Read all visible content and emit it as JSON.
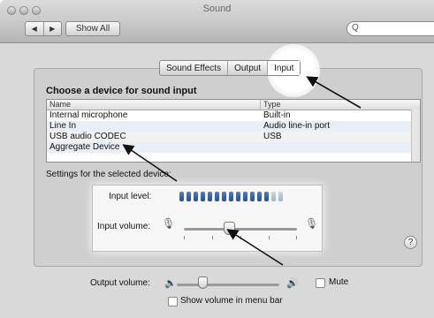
{
  "window": {
    "title": "Sound"
  },
  "toolbar": {
    "back_label": "◀",
    "forward_label": "▶",
    "show_all_label": "Show All",
    "search_icon": "Q"
  },
  "tabs": [
    {
      "label": "Sound Effects",
      "active": false
    },
    {
      "label": "Output",
      "active": false
    },
    {
      "label": "Input",
      "active": true
    }
  ],
  "input": {
    "heading": "Choose a device for sound input",
    "columns": {
      "name": "Name",
      "type": "Type"
    },
    "devices": [
      {
        "name": "Internal microphone",
        "type": "Built-in"
      },
      {
        "name": "Line In",
        "type": "Audio line-in port"
      },
      {
        "name": "USB audio CODEC",
        "type": "USB",
        "selected": true
      },
      {
        "name": "Aggregate Device",
        "type": ""
      }
    ],
    "settings_label": "Settings for the selected device:",
    "level_label": "Input level:",
    "level_segments_lit": 13,
    "level_segments_total": 15,
    "volume_label": "Input volume:",
    "volume_fraction": 0.4
  },
  "help_label": "?",
  "output": {
    "volume_label": "Output volume:",
    "volume_fraction": 0.25,
    "mute_label": "Mute",
    "show_menu_bar_label": "Show volume in menu bar"
  },
  "colors": {
    "meter_on": "#2f63bd",
    "meter_off": "#b5c4e0",
    "window_bg": "#d9d9d9"
  }
}
